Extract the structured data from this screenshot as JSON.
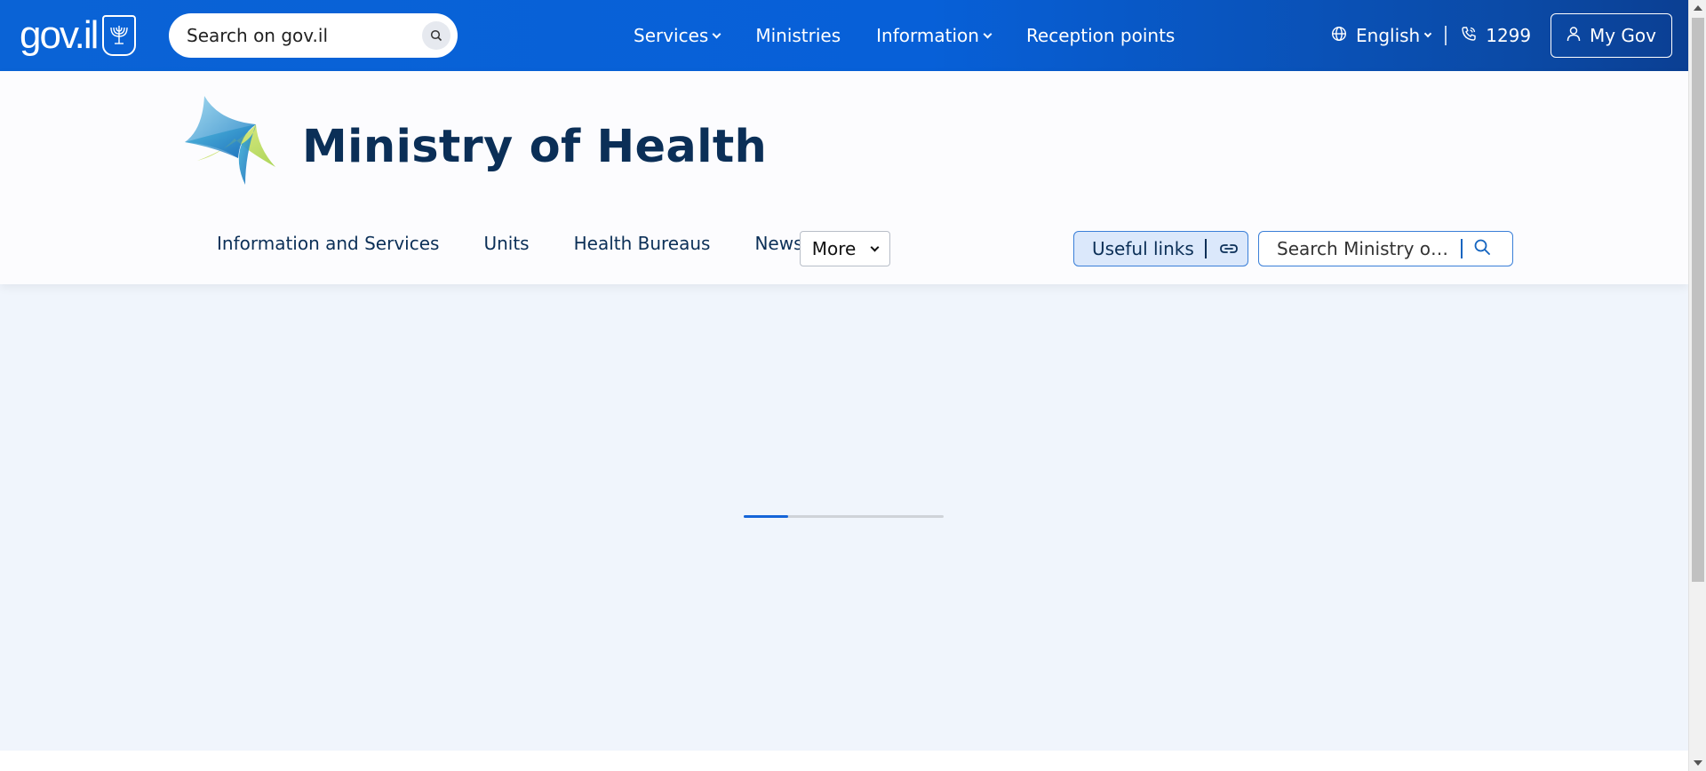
{
  "topbar": {
    "logo_text": "gov.il",
    "search_placeholder": "Search on gov.il",
    "nav": [
      {
        "label": "Services",
        "has_dropdown": true
      },
      {
        "label": "Ministries",
        "has_dropdown": false
      },
      {
        "label": "Information",
        "has_dropdown": true
      },
      {
        "label": "Reception points",
        "has_dropdown": false
      }
    ],
    "language": "English",
    "phone": "1299",
    "my_gov": "My Gov"
  },
  "ministry": {
    "title": "Ministry of Health",
    "nav": [
      "Information and Services",
      "Units",
      "Health Bureaus",
      "News"
    ],
    "more_label": "More",
    "useful_links_label": "Useful links",
    "search_placeholder": "Search Ministry of Health"
  },
  "loader": {
    "progress": 0.22
  },
  "colors": {
    "topbar_blue": "#0a63d6",
    "title_navy": "#0b2f57",
    "accent_blue": "#3a7fd8",
    "page_bg": "#f0f5fc"
  },
  "icons": {
    "gov_search": "search-icon",
    "language": "globe-icon",
    "phone": "phone-icon",
    "my_gov": "user-icon",
    "useful_links": "link-icon",
    "ministry_search": "search-icon"
  }
}
